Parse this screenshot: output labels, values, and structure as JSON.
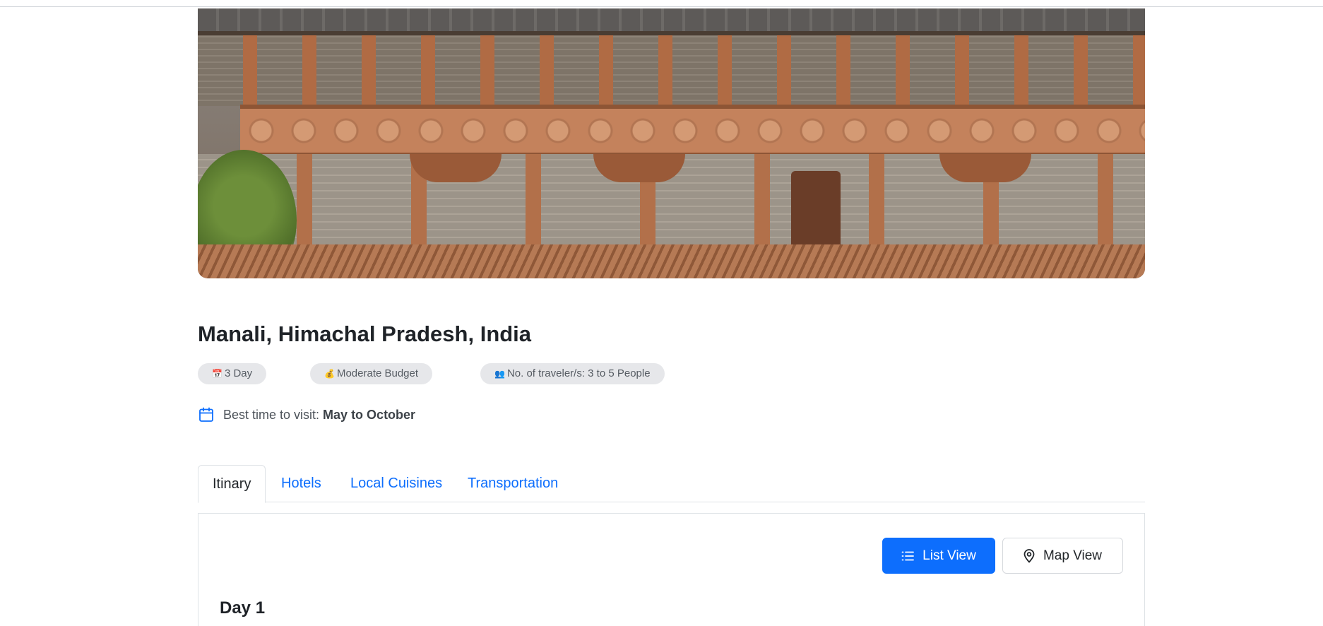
{
  "destination": {
    "title": "Manali, Himachal Pradesh, India",
    "hero_image_alt": "Traditional wooden Himachali building with carved balconies"
  },
  "badges": [
    {
      "icon": "calendar-emoji",
      "emoji": "📅",
      "label": "3 Day"
    },
    {
      "icon": "money-bag-emoji",
      "emoji": "💰",
      "label": "Moderate Budget"
    },
    {
      "icon": "people-emoji",
      "emoji": "👥",
      "label": "No. of traveler/s: 3 to 5 People"
    }
  ],
  "best_time": {
    "icon": "calendar-icon",
    "label": "Best time to visit:",
    "value": "May to October"
  },
  "tabs": [
    {
      "label": "Itinary",
      "active": true
    },
    {
      "label": "Hotels",
      "active": false
    },
    {
      "label": "Local Cuisines",
      "active": false
    },
    {
      "label": "Transportation",
      "active": false
    }
  ],
  "view_toggle": {
    "list_label": "List View",
    "list_icon": "list-icon",
    "map_label": "Map View",
    "map_icon": "map-pin-icon"
  },
  "itinerary": {
    "day_heading": "Day 1"
  },
  "colors": {
    "accent": "#0d6efd",
    "badge_bg": "#e6e7ea",
    "title": "#1f2328"
  }
}
